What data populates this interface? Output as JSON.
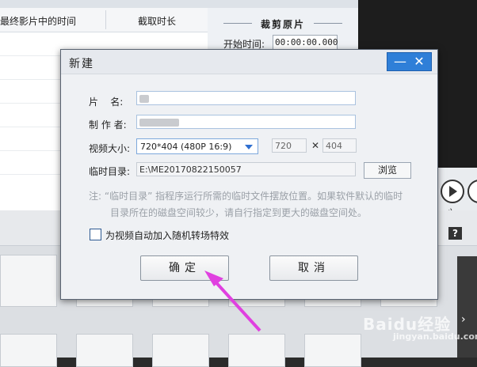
{
  "background": {
    "table_columns": [
      "最终影片中的时间",
      "截取时长"
    ],
    "crop_panel": {
      "title": "裁剪原片",
      "start_label": "开始时间:",
      "start_value": "00:00:00.000"
    },
    "help_label": "?",
    "side_arrow": "›"
  },
  "dialog": {
    "title": "新建",
    "minimize": "—",
    "close": "✕",
    "name_label": "片    名:",
    "author_label": "制 作 者:",
    "size_label": "视频大小:",
    "size_value": "720*404 (480P 16:9)",
    "width_value": "720",
    "x_sep": "✕",
    "height_value": "404",
    "tempdir_label": "临时目录:",
    "tempdir_value": "E:\\ME20170822150057",
    "browse_label": "浏览",
    "note_line1": "注: “临时目录” 指程序运行所需的临时文件摆放位置。如果软件默认的临时",
    "note_line2": "目录所在的磁盘空间较少，请自行指定到更大的磁盘空间处。",
    "checkbox_label": "为视频自动加入随机转场特效",
    "ok_label": "确定",
    "cancel_label": "取消"
  },
  "watermark": {
    "text": "Baidu经验",
    "sub": "jingyan.baidu.com"
  },
  "colors": {
    "accent": "#2f7fd8",
    "arrow": "#e040e0"
  }
}
